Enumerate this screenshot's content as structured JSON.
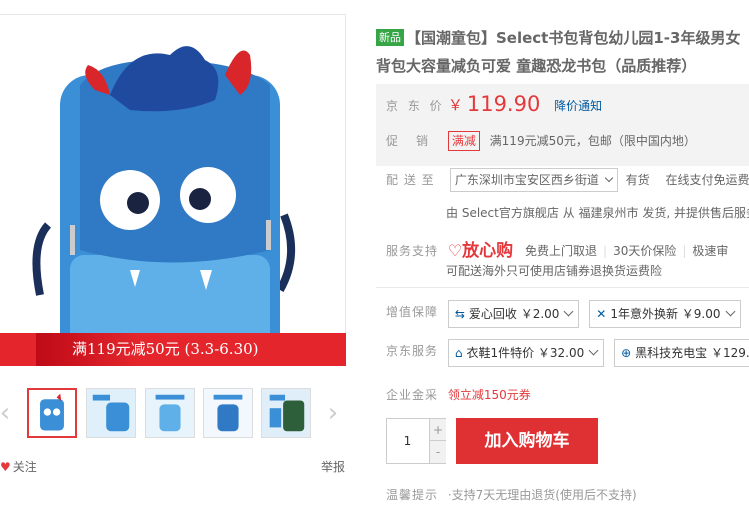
{
  "gallery": {
    "promo_banner": "满119元减50元 (3.3-6.30)",
    "follow_label": "关注",
    "report_label": "举报"
  },
  "product": {
    "new_tag": "新品",
    "title_line1": "【国潮童包】Select书包背包幼儿园1-3年级男女",
    "title_line2": "背包大容量减负可爱 童趣恐龙书包（品质推荐）"
  },
  "price": {
    "label": "京 东 价",
    "currency": "￥",
    "value": "119.90",
    "notify": "降价通知"
  },
  "promo": {
    "label": "促　销",
    "tag": "满减",
    "text": "满119元减50元，包邮（限中国内地）"
  },
  "delivery": {
    "label": "配 送 至",
    "address": "广东深圳市宝安区西乡街道",
    "stock": "有货",
    "free": "在线支付免运费",
    "seller_prefix": "由",
    "seller_shop": "Select官方旗舰店",
    "seller_suffix": "从 福建泉州市 发货, 并提供售后服务"
  },
  "service": {
    "label": "服务支持",
    "logo": "放心购",
    "items": [
      "免费上门取退",
      "30天价保险",
      "极速审"
    ],
    "note": "可配送海外只可使用店铺券退换货运费险"
  },
  "value_added": {
    "label": "增值保障",
    "options": [
      {
        "icon": "recycle-icon",
        "text": "爱心回收 ￥2.00"
      },
      {
        "icon": "wrench-icon",
        "text": "1年意外换新 ￥9.00"
      }
    ]
  },
  "jd_service": {
    "label": "京东服务",
    "options": [
      {
        "icon": "shoe-icon",
        "text": "衣鞋1件特价 ￥32.00"
      },
      {
        "icon": "charger-icon",
        "text": "黑科技充电宝 ￥129."
      }
    ]
  },
  "enterprise": {
    "label": "企业金采",
    "link": "领立减150元券"
  },
  "purchase": {
    "quantity": "1",
    "plus": "+",
    "minus": "-",
    "cart_button": "加入购物车"
  },
  "tips": {
    "label": "温馨提示",
    "text": "·支持7天无理由退货(使用后不支持)"
  },
  "colors": {
    "accent_red": "#e4393c",
    "cart_red": "#df3033",
    "link_blue": "#005aa0",
    "new_green": "#36a546"
  }
}
